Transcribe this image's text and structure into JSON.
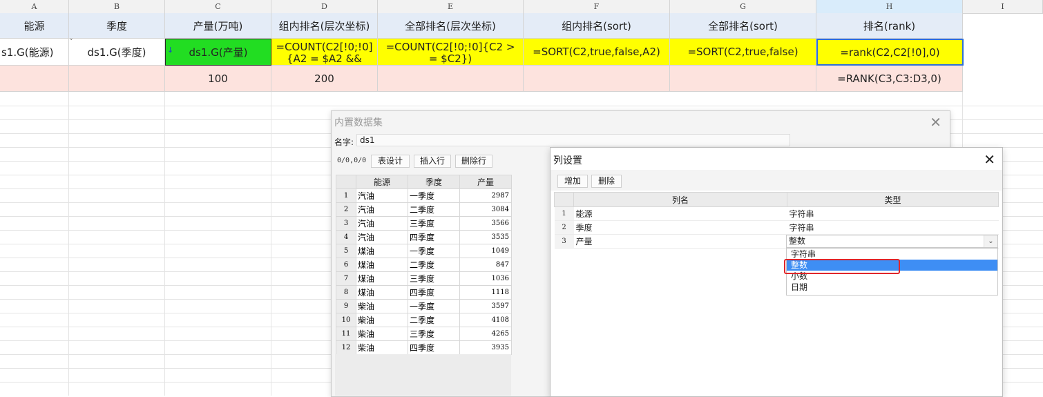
{
  "sheet": {
    "columns": [
      "A",
      "B",
      "C",
      "D",
      "E",
      "F",
      "G",
      "H",
      "I"
    ],
    "row1": [
      "能源",
      "季度",
      "产量(万吨)",
      "组内排名(层次坐标)",
      "全部排名(层次坐标)",
      "组内排名(sort)",
      "全部排名(sort)",
      "排名(rank)"
    ],
    "row2": [
      "s1.G(能源)",
      "ds1.G(季度)",
      "ds1.G(产量)",
      "=COUNT(C2[!0;!0]{A2 = $A2 &&",
      "=COUNT(C2[!0;!0]{C2 >= $C2})",
      "=SORT(C2,true,false,A2)",
      "=SORT(C2,true,false)",
      "=rank(C2,C2[!0],0)"
    ],
    "row3": [
      "",
      "",
      "100",
      "200",
      "",
      "",
      "",
      "=RANK(C3,C3:D3,0)"
    ],
    "colors": {
      "yellow": "#ffff00",
      "green": "#22dd22",
      "header_row": "#e4ecf7",
      "pink_row": "#fde3de",
      "selection": "#2f6fd6"
    }
  },
  "dataset_dialog": {
    "title": "内置数据集",
    "name_label": "名字:",
    "name_value": "ds1",
    "coord": "0/0,0/0",
    "buttons": {
      "design": "表设计",
      "insert_row": "插入行",
      "delete_row": "删除行"
    },
    "headers": [
      "能源",
      "季度",
      "产量"
    ],
    "rows": [
      [
        "1",
        "汽油",
        "一季度",
        "2987"
      ],
      [
        "2",
        "汽油",
        "二季度",
        "3084"
      ],
      [
        "3",
        "汽油",
        "三季度",
        "3566"
      ],
      [
        "4",
        "汽油",
        "四季度",
        "3535"
      ],
      [
        "5",
        "煤油",
        "一季度",
        "1049"
      ],
      [
        "6",
        "煤油",
        "二季度",
        "847"
      ],
      [
        "7",
        "煤油",
        "三季度",
        "1036"
      ],
      [
        "8",
        "煤油",
        "四季度",
        "1118"
      ],
      [
        "9",
        "柴油",
        "一季度",
        "3597"
      ],
      [
        "10",
        "柴油",
        "二季度",
        "4108"
      ],
      [
        "11",
        "柴油",
        "三季度",
        "4265"
      ],
      [
        "12",
        "柴油",
        "四季度",
        "3935"
      ]
    ]
  },
  "column_dialog": {
    "title": "列设置",
    "buttons": {
      "add": "增加",
      "delete": "删除"
    },
    "headers": [
      "列名",
      "类型"
    ],
    "rows": [
      {
        "idx": "1",
        "name": "能源",
        "type": "字符串"
      },
      {
        "idx": "2",
        "name": "季度",
        "type": "字符串"
      },
      {
        "idx": "3",
        "name": "产量",
        "type": "整数"
      }
    ],
    "dropdown_options": [
      "字符串",
      "整数",
      "小数",
      "日期"
    ],
    "highlight_color": "#3e8ef4",
    "outline_color": "#e0262b"
  }
}
